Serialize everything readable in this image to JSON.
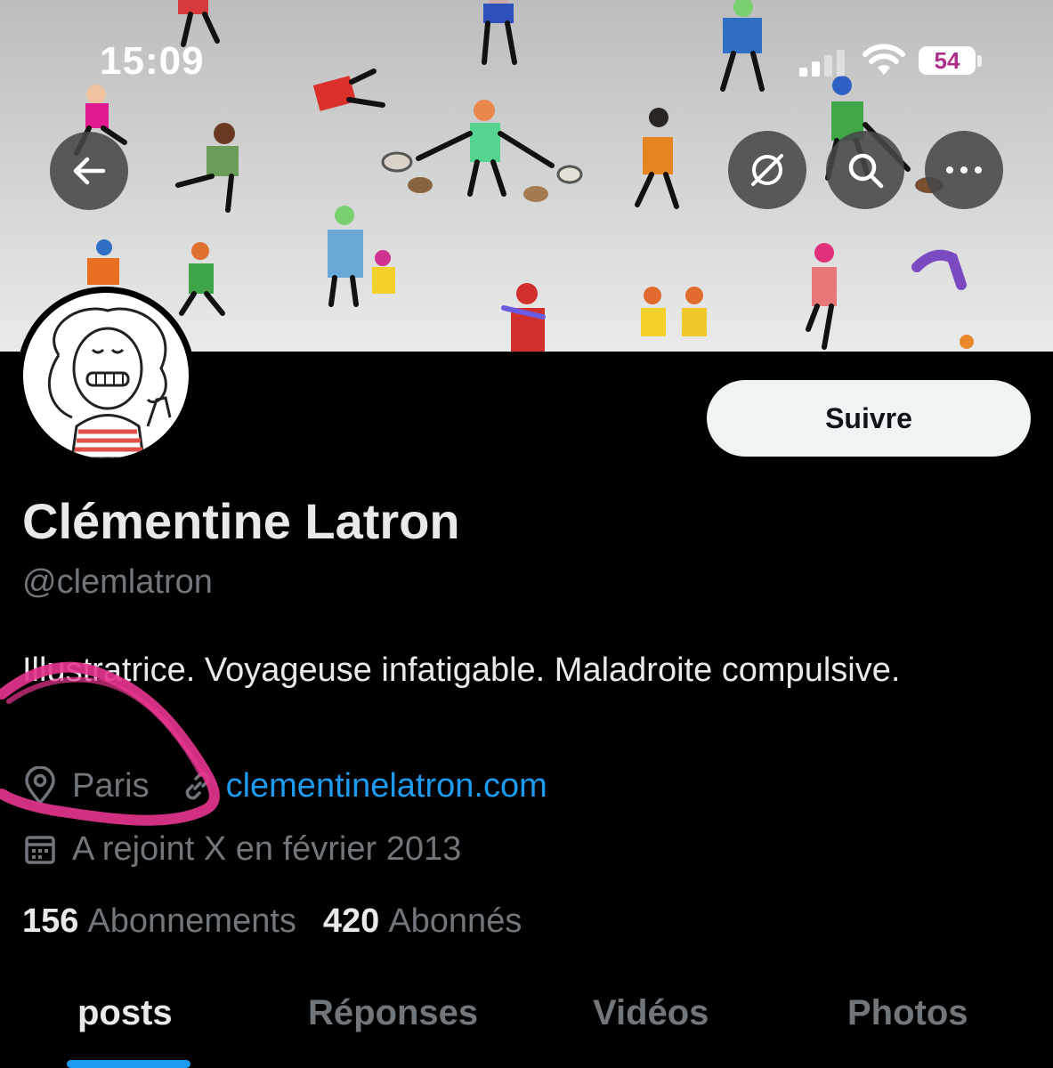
{
  "status_bar": {
    "time": "15:09",
    "battery": "54"
  },
  "header_buttons": {
    "back_icon": "arrow-left-icon",
    "grok_icon": "grok-icon",
    "search_icon": "search-icon",
    "more_icon": "more-horizontal-icon"
  },
  "profile": {
    "follow_label": "Suivre",
    "display_name": "Clémentine Latron",
    "handle": "@clemlatron",
    "bio": "Illustratrice. Voyageuse infatigable. Maladroite compulsive.",
    "location": "Paris",
    "website": "clementinelatron.com",
    "joined": "A rejoint X en février 2013",
    "following_count": "156",
    "following_label": "Abonnements",
    "followers_count": "420",
    "followers_label": "Abonnés"
  },
  "tabs": [
    {
      "label": "posts",
      "active": true
    },
    {
      "label": "Réponses",
      "active": false
    },
    {
      "label": "Vidéos",
      "active": false
    },
    {
      "label": "Photos",
      "active": false
    }
  ],
  "colors": {
    "background": "#000000",
    "text_primary": "#e7e9ea",
    "text_secondary": "#71767b",
    "link": "#1d9bf0",
    "tab_indicator": "#1d9bf0",
    "follow_button_bg": "#eff3f4",
    "annotation_scribble": "#e8348f"
  }
}
